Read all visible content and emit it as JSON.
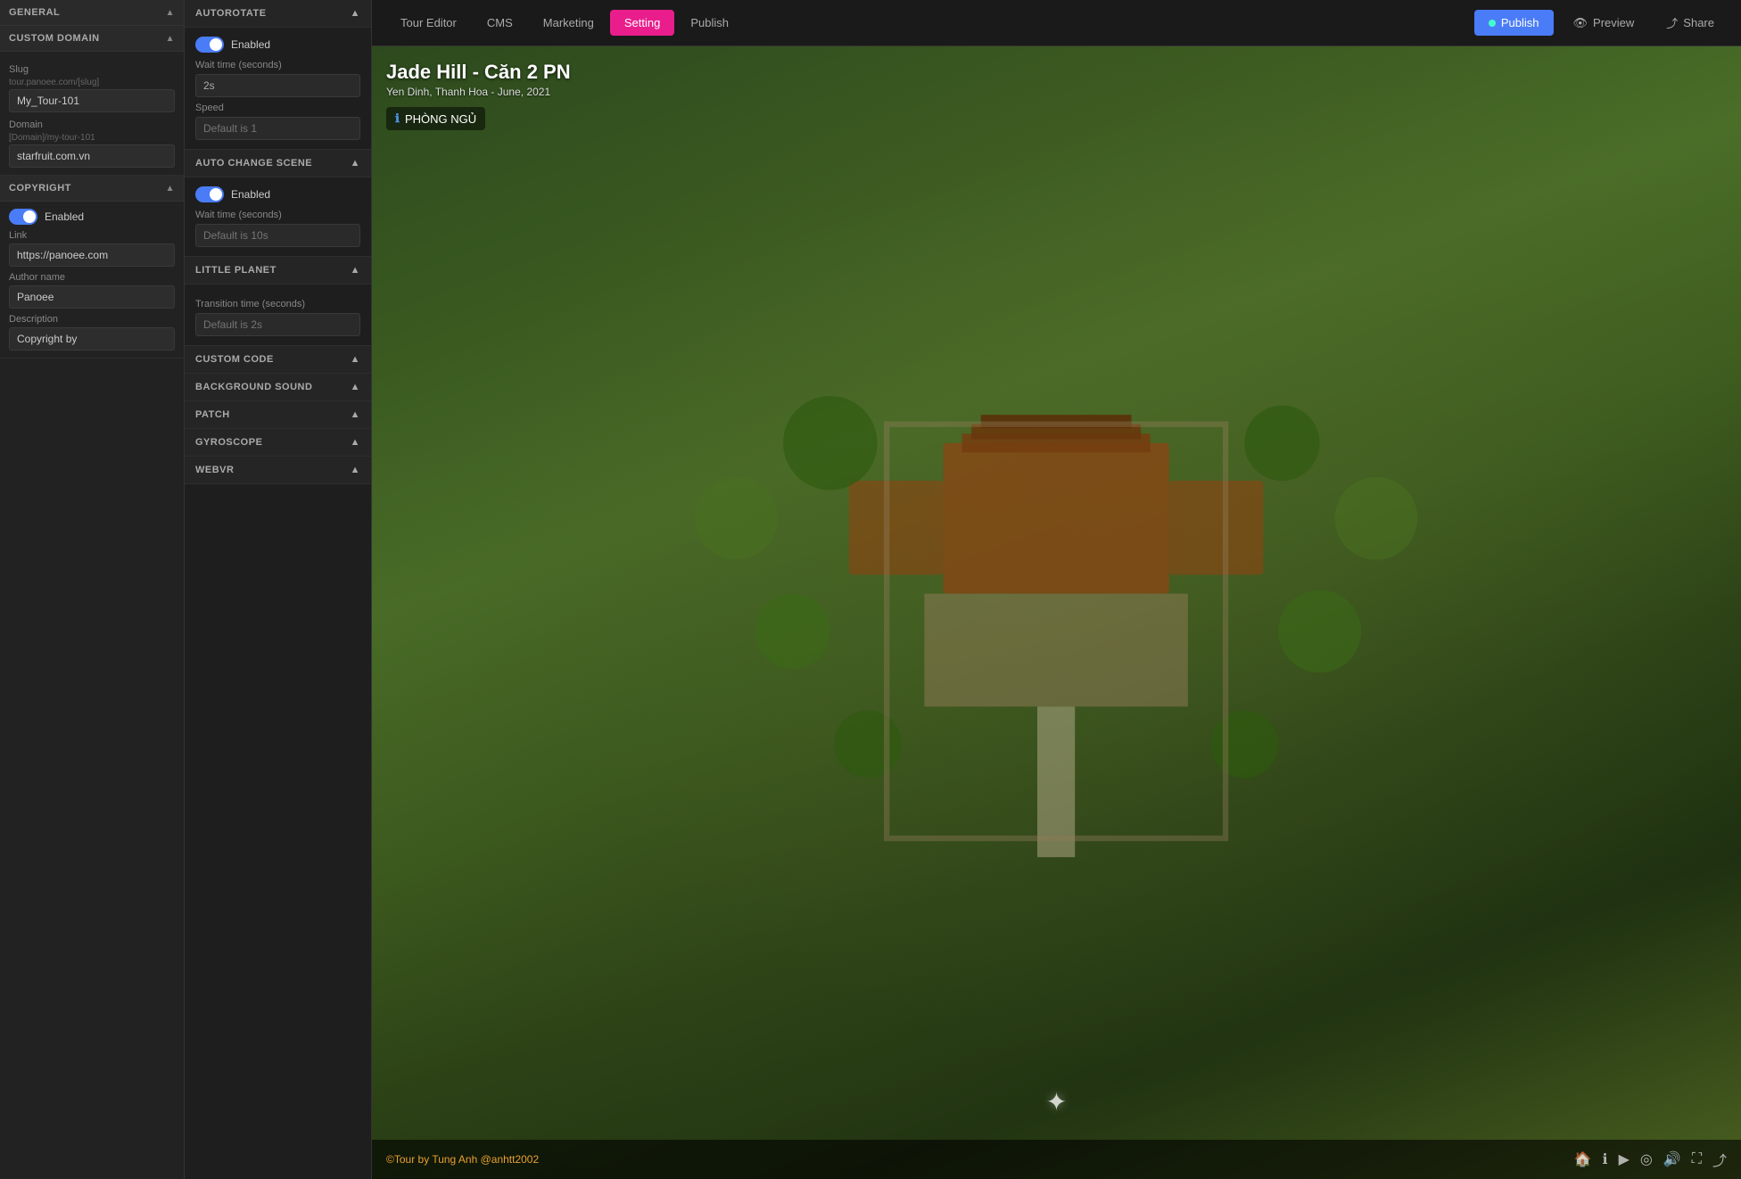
{
  "leftPanel": {
    "general_label": "GENERAL",
    "customDomain": {
      "header": "CUSTOM DOMAIN",
      "slug_label": "Slug",
      "slug_note": "tour.panoee.com/[slug]",
      "slug_value": "My_Tour-101",
      "domain_label": "Domain",
      "domain_note": "[Domain]/my-tour-101",
      "domain_value": "starfruit.com.vn"
    },
    "copyright": {
      "header": "COPYRIGHT",
      "enabled_label": "Enabled",
      "link_label": "Link",
      "link_value": "https://panoee.com",
      "author_label": "Author name",
      "author_value": "Panoee",
      "desc_label": "Description",
      "desc_value": "Copyright by"
    }
  },
  "middlePanel": {
    "autorotate": {
      "header": "AUTOROTATE",
      "enabled_label": "Enabled",
      "wait_label": "Wait time (seconds)",
      "wait_value": "2s",
      "speed_label": "Speed",
      "speed_value": "Default is 1"
    },
    "autoChangeScene": {
      "header": "AUTO CHANGE SCENE",
      "enabled_label": "Enabled",
      "wait_label": "Wait time (seconds)",
      "wait_value": "Default is 10s"
    },
    "littlePlanet": {
      "header": "LITTLE PLANET",
      "transition_label": "Transition time (seconds)",
      "transition_value": "Default is 2s"
    },
    "customCode": {
      "header": "CUSTOM CODE"
    },
    "backgroundSound": {
      "header": "BACKGROUND SOUND"
    },
    "patch": {
      "header": "PATCH"
    },
    "gyroscope": {
      "header": "GYROSCOPE"
    },
    "webvr": {
      "header": "WEBVR"
    }
  },
  "topNav": {
    "tabs": [
      {
        "label": "Tour Editor",
        "active": false
      },
      {
        "label": "CMS",
        "active": false
      },
      {
        "label": "Marketing",
        "active": false
      },
      {
        "label": "Setting",
        "active": true
      },
      {
        "label": "Publish",
        "active": false
      }
    ],
    "publish_label": "Publish",
    "preview_label": "Preview",
    "share_label": "Share"
  },
  "tourView": {
    "title": "Jade Hill - Căn 2 PN",
    "subtitle": "Yen Dinh, Thanh Hoa - June, 2021",
    "badge": "PHÒNG NGỦ",
    "copyright": "©Tour by",
    "author": "Tung Anh @anhtt2002"
  }
}
